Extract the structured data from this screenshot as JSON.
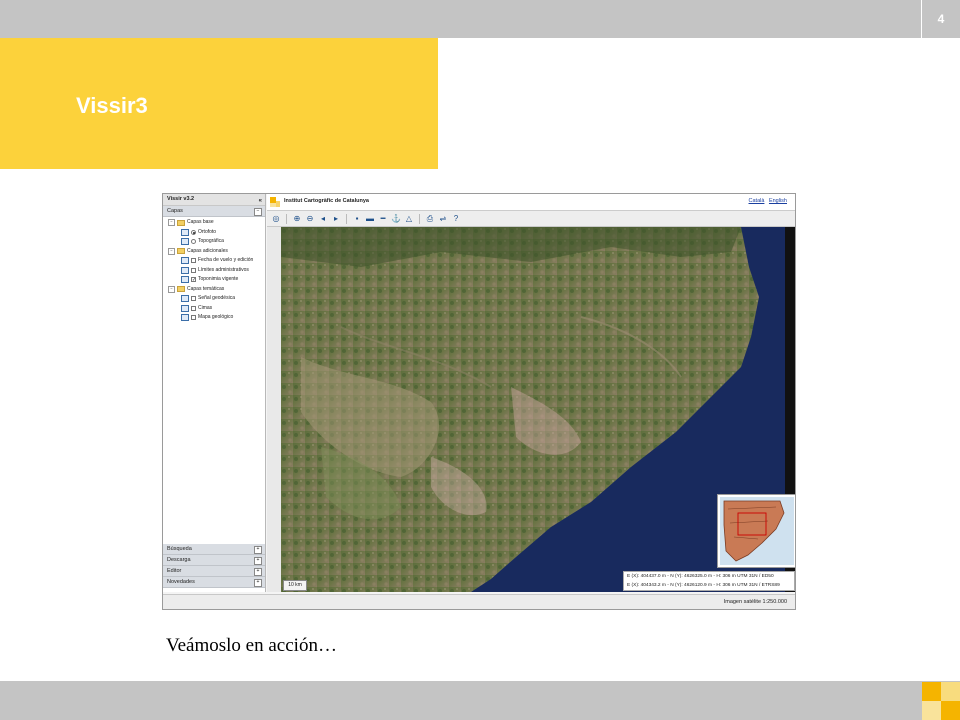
{
  "slide": {
    "page_number": "4",
    "title": "Vissir3",
    "caption": "Veámoslo en acción…"
  },
  "colors": {
    "title_block": "#fcd23b",
    "bars": "#c4c4c4",
    "sea": "#182a5e"
  },
  "app": {
    "version": "Vissir v3.2",
    "panel_title": "Capas",
    "header_title": "Institut Cartogràfic de Catalunya",
    "languages": [
      "Català",
      "English"
    ],
    "tree": [
      {
        "level": 0,
        "type": "folder",
        "label": "Capas base"
      },
      {
        "level": 1,
        "type": "radio",
        "checked": true,
        "label": "Ortofoto"
      },
      {
        "level": 1,
        "type": "radio",
        "checked": false,
        "label": "Topográfica"
      },
      {
        "level": 0,
        "type": "folder",
        "label": "Capas adicionales"
      },
      {
        "level": 1,
        "type": "checkbox",
        "checked": false,
        "label": "Fecha de vuelo y edición"
      },
      {
        "level": 1,
        "type": "checkbox",
        "checked": false,
        "label": "Límites administrativos"
      },
      {
        "level": 1,
        "type": "checkbox",
        "checked": true,
        "label": "Toponimia vigente"
      },
      {
        "level": 0,
        "type": "folder",
        "label": "Capas temáticas"
      },
      {
        "level": 1,
        "type": "checkbox",
        "checked": false,
        "label": "Señal geodésica"
      },
      {
        "level": 1,
        "type": "checkbox",
        "checked": false,
        "label": "Cimas"
      },
      {
        "level": 1,
        "type": "checkbox",
        "checked": false,
        "label": "Mapa geológico"
      }
    ],
    "bottom_sections": [
      "Búsqueda",
      "Descarga",
      "Editor",
      "Novedades"
    ],
    "toolbar_icons": [
      "globe-icon",
      "zoom-in-icon",
      "zoom-out-icon",
      "back-icon",
      "forward-icon",
      "save-icon",
      "layers-icon",
      "measure-icon",
      "anchor-icon",
      "triangle-icon",
      "print-icon",
      "link-icon",
      "help-icon"
    ],
    "scale_label": "10 km",
    "coords": [
      "E (X): 404437.0 m - N (Y): 4626325.0 m - H: 306 m UTM 31N / ED50",
      "E (X): 404343.2 m - N (Y): 4626120.9 m - H: 306 m UTM 31N / ETRS89"
    ],
    "status": "Imagen satélite 1:250.000"
  }
}
